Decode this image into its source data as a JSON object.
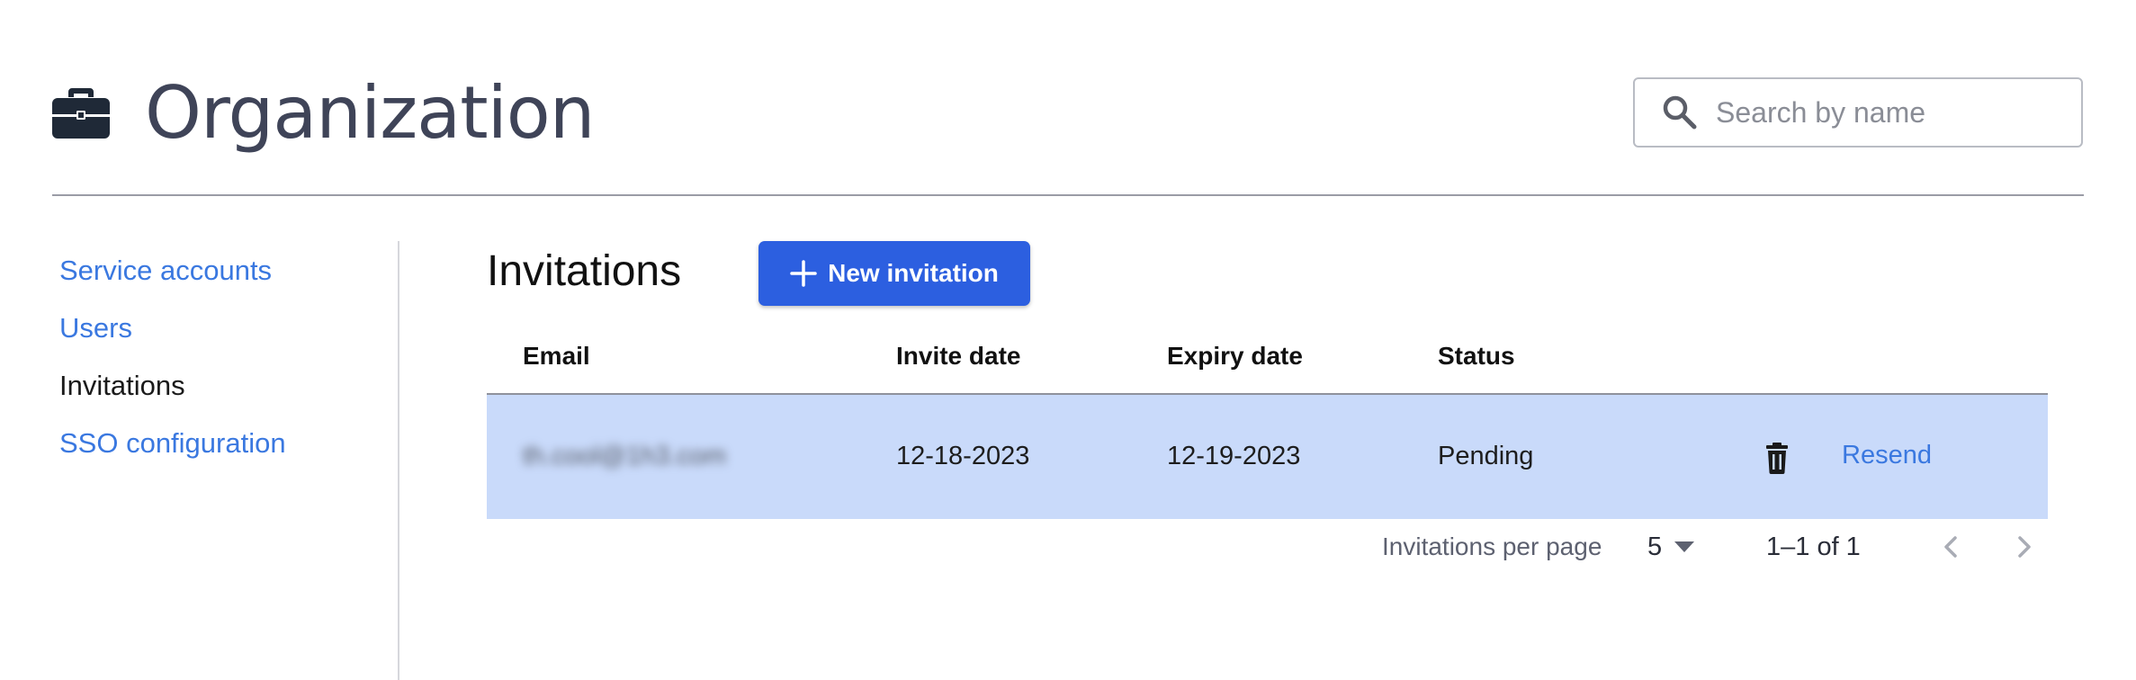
{
  "header": {
    "title": "Organization",
    "brand_icon": "briefcase-icon",
    "search": {
      "placeholder": "Search by name",
      "value": ""
    }
  },
  "sidebar": {
    "items": [
      {
        "label": "Service accounts",
        "active": false
      },
      {
        "label": "Users",
        "active": false
      },
      {
        "label": "Invitations",
        "active": true
      },
      {
        "label": "SSO configuration",
        "active": false
      }
    ]
  },
  "main": {
    "title": "Invitations",
    "new_button_label": "New invitation",
    "table": {
      "columns": [
        "Email",
        "Invite date",
        "Expiry date",
        "Status"
      ],
      "rows": [
        {
          "email": "th.cool@1h3.com",
          "invite_date": "12-18-2023",
          "expiry_date": "12-19-2023",
          "status": "Pending",
          "action_label": "Resend"
        }
      ]
    },
    "pagination": {
      "per_page_label": "Invitations per page",
      "per_page_value": "5",
      "range": "1–1 of 1"
    }
  },
  "colors": {
    "accent": "#2c5fe0",
    "link": "#3a78e0",
    "row_highlight": "#c9dafa",
    "title": "#3f4458"
  }
}
